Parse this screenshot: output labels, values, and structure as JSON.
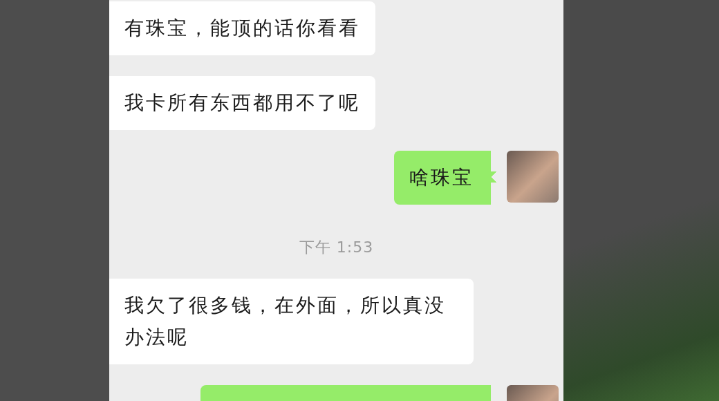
{
  "messages": [
    {
      "kind": "incoming",
      "text": "有珠宝，能顶的话你看看"
    },
    {
      "kind": "incoming",
      "text": "我卡所有东西都用不了呢"
    },
    {
      "kind": "outgoing",
      "text": "啥珠宝"
    },
    {
      "kind": "time",
      "text": "下午 1:53"
    },
    {
      "kind": "incoming",
      "text": "我欠了很多钱，在外面，所以真没办法呢"
    },
    {
      "kind": "outgoing"
    }
  ]
}
